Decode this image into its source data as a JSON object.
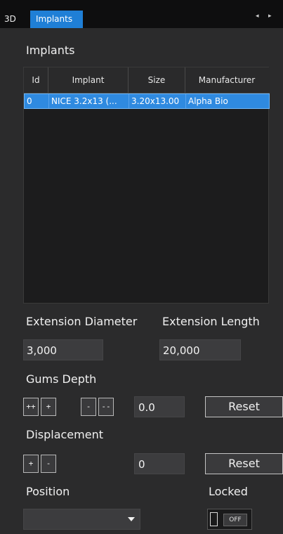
{
  "tabs": [
    {
      "label": "3D"
    },
    {
      "label": "Implants"
    }
  ],
  "nav": {
    "left": "◂",
    "right": "▸"
  },
  "implants_title": "Implants",
  "table": {
    "columns": [
      "Id",
      "Implant",
      "Size",
      "Manufacturer"
    ],
    "rows": [
      {
        "id": "0",
        "implant": "NICE 3.2x13 (...",
        "size": "3.20x13.00",
        "manufacturer": "Alpha Bio"
      }
    ]
  },
  "extension": {
    "diameter_label": "Extension Diameter",
    "length_label": "Extension Length",
    "diameter_value": "3,000",
    "length_value": "20,000"
  },
  "gums": {
    "label": "Gums Depth",
    "buttons": [
      "++",
      "+",
      "-",
      "--"
    ],
    "value": "0.0",
    "reset": "Reset"
  },
  "displacement": {
    "label": "Displacement",
    "buttons": [
      "+",
      "-"
    ],
    "value": "0",
    "reset": "Reset"
  },
  "position": {
    "label": "Position",
    "selected": ""
  },
  "locked": {
    "label": "Locked",
    "state": "OFF"
  }
}
